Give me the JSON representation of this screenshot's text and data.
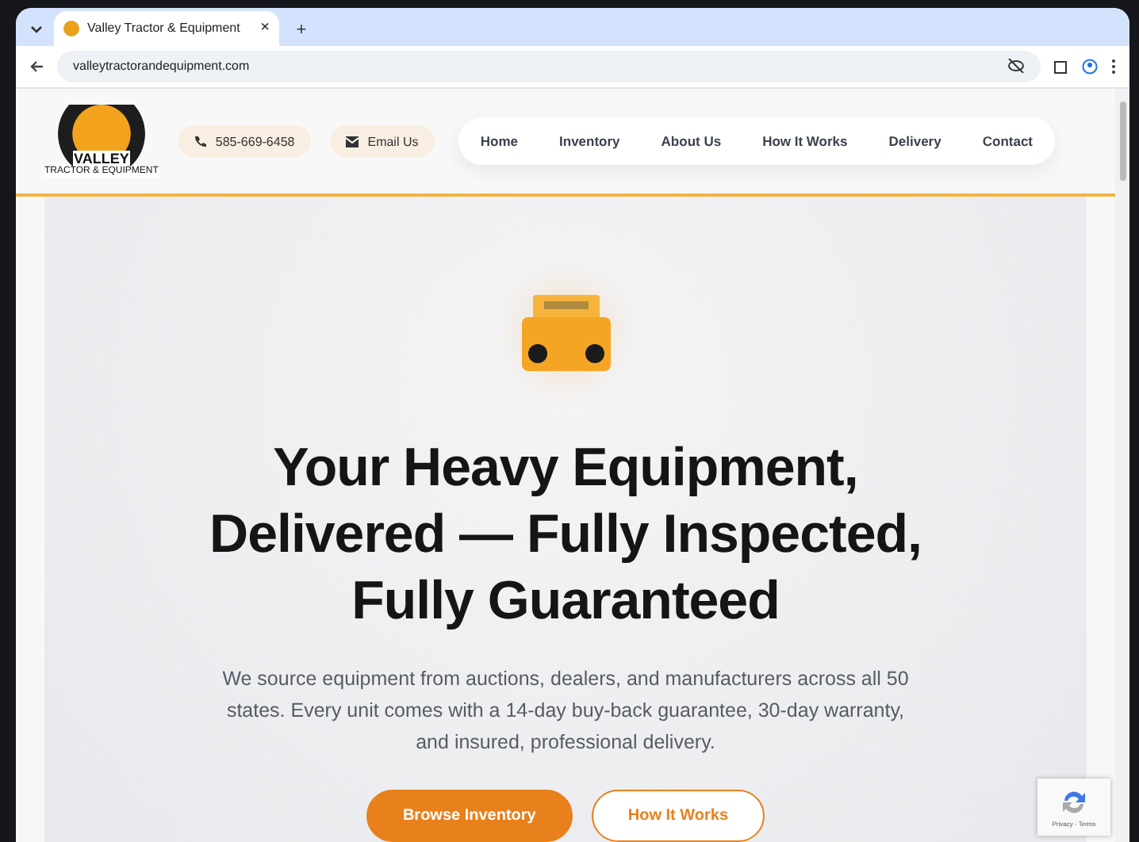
{
  "browser": {
    "tabs": [
      {
        "title": "Valley Tractor & Equipment",
        "selected": true
      }
    ],
    "new_tab": "+",
    "close": "×",
    "url": "valleytractorandequipment.com"
  },
  "header": {
    "logo": {
      "name": "VALLEY",
      "tagline": "TRACTOR & EQUIPMENT"
    },
    "phone": "585-669-6458",
    "email": "Email Us",
    "nav": [
      {
        "label": "Home"
      },
      {
        "label": "Inventory"
      },
      {
        "label": "About Us"
      },
      {
        "label": "How It Works"
      },
      {
        "label": "Delivery"
      },
      {
        "label": "Contact"
      }
    ]
  },
  "hero": {
    "title_lines": [
      "Your Heavy Equipment,",
      "Delivered — Fully Inspected,",
      "Fully Guaranteed"
    ],
    "description": "We source equipment from auctions, dealers, and manufacturers across all 50 states. Every unit comes with a 14-day buy-back guarantee, 30-day warranty, and insured, professional delivery.",
    "buttons": [
      {
        "label": "Browse Inventory",
        "kind": "primary"
      },
      {
        "label": "How It Works",
        "kind": "secondary"
      }
    ]
  },
  "recaptcha": {
    "links": "Privacy - Terms"
  }
}
